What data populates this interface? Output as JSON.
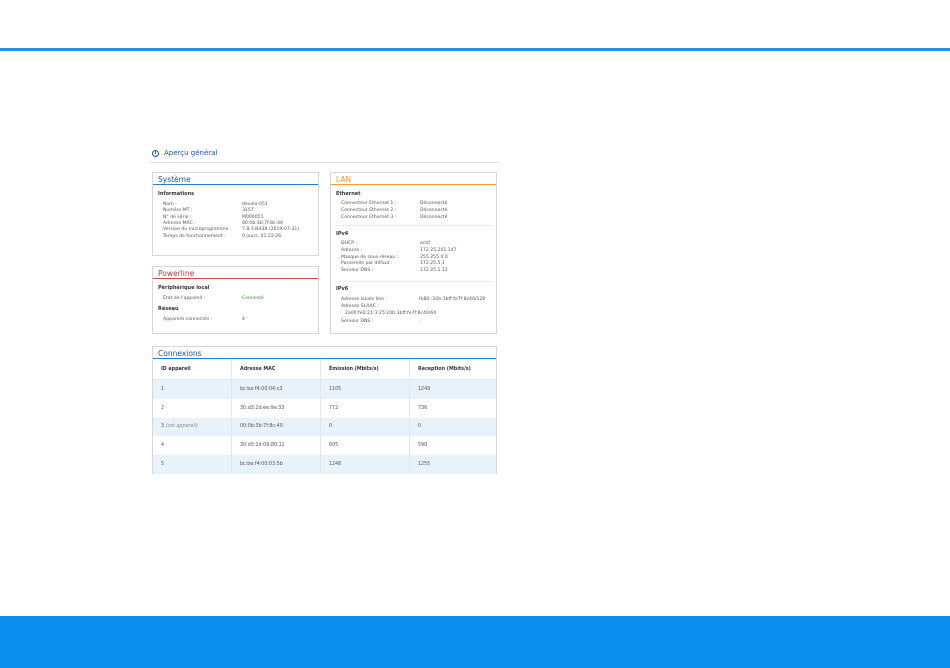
{
  "overview_title": "Aperçu général",
  "system": {
    "title": "Système",
    "section": "Informations",
    "rows": [
      {
        "label": "Nom :",
        "value": "devolo-051"
      },
      {
        "label": "Numéro MT :",
        "value": "3157"
      },
      {
        "label": "N° de série :",
        "value": "M000051"
      },
      {
        "label": "Adresse MAC :",
        "value": "00:0b:3b:7f:8c:40"
      },
      {
        "label": "Version du microprogramme :",
        "value": "7.8.3.N438 (2019-07-31)"
      },
      {
        "label": "Temps de fonctionnement :",
        "value": "0 jours, 01:22:26"
      }
    ]
  },
  "powerline": {
    "title": "Powerline",
    "local_section": "Périphérique local",
    "local_rows": [
      {
        "label": "État de l'appareil :",
        "value": "Connecté"
      }
    ],
    "network_section": "Réseau",
    "network_rows": [
      {
        "label": "Appareils connectés :",
        "value": "4"
      }
    ]
  },
  "lan": {
    "title": "LAN",
    "ethernet_section": "Ethernet",
    "ethernet_rows": [
      {
        "label": "Connecteur Ethernet 1 :",
        "value": "Déconnecté"
      },
      {
        "label": "Connecteur Ethernet 2 :",
        "value": "Déconnecté"
      },
      {
        "label": "Connecteur Ethernet 3 :",
        "value": "Déconnecté"
      }
    ],
    "ipv4_section": "IPv4",
    "ipv4_rows": [
      {
        "label": "DHCP :",
        "value": "actif"
      },
      {
        "label": "Adresse :",
        "value": "172.25.201.147"
      },
      {
        "label": "Masque de sous-réseau :",
        "value": "255.255.0.0"
      },
      {
        "label": "Passerelle par défaut :",
        "value": "172.25.5.1"
      },
      {
        "label": "Serveur DNS :",
        "value": "172.25.1.12"
      }
    ],
    "ipv6_section": "IPv6",
    "ipv6_link_label": "Adresse locale lien :",
    "ipv6_link_value": "fe80::20b:3bff:fe7f:8c40/128",
    "ipv6_slaac_label": "Adresse SLAAC :",
    "ipv6_slaac_value": "2a00:fe0:21:3:25:20b:3bff:fe7f:8c40/64",
    "ipv6_dns_label": "Serveur DNS :",
    "ipv6_dns_value": "-"
  },
  "connections": {
    "title": "Connexions",
    "headers": [
      "ID appareil",
      "Adresse MAC",
      "Émission (Mbits/s)",
      "Réception (Mbits/s)"
    ],
    "rows": [
      {
        "id": "1",
        "id_note": "",
        "mac": "bc:be:f4:00:04:c3",
        "tx": "1105",
        "rx": "1249"
      },
      {
        "id": "2",
        "id_note": "",
        "mac": "30:d3:2d:ee:9e:33",
        "tx": "772",
        "rx": "736"
      },
      {
        "id": "3",
        "id_note": "(cet appareil)",
        "mac": "00:0b:3b:7f:8c:40",
        "tx": "0",
        "rx": "0"
      },
      {
        "id": "4",
        "id_note": "",
        "mac": "30:d3:2d:09:80:12",
        "tx": "605",
        "rx": "590"
      },
      {
        "id": "5",
        "id_note": "",
        "mac": "bc:be:f4:00:03:5b",
        "tx": "1248",
        "rx": "1255"
      }
    ]
  }
}
